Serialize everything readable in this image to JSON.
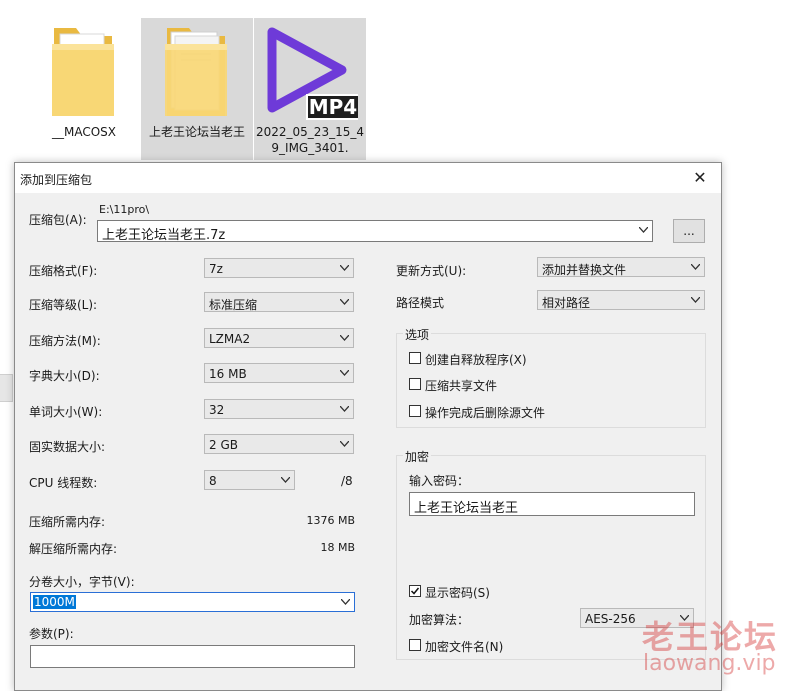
{
  "explorer": {
    "files": [
      {
        "name": "__MACOSX",
        "icon": "folder-icon"
      },
      {
        "name": "上老王论坛当老王",
        "icon": "folder-icon"
      },
      {
        "name": "2022_05_23_15_49_IMG_3401.",
        "icon": "mp4-video-icon",
        "badge": "MP4"
      }
    ]
  },
  "dialog": {
    "title": "添加到压缩包",
    "archive_label": "压缩包(A):",
    "archive_path": "E:\\11pro\\",
    "archive_name": "上老王论坛当老王.7z",
    "browse_label": "...",
    "left": {
      "format_label": "压缩格式(F):",
      "format_value": "7z",
      "level_label": "压缩等级(L):",
      "level_value": "标准压缩",
      "method_label": "压缩方法(M):",
      "method_value": "LZMA2",
      "dict_label": "字典大小(D):",
      "dict_value": "16 MB",
      "word_label": "单词大小(W):",
      "word_value": "32",
      "solid_label": "固实数据大小:",
      "solid_value": "2 GB",
      "threads_label": "CPU 线程数:",
      "threads_value": "8",
      "threads_max": "/8",
      "mem_compress_label": "压缩所需内存:",
      "mem_compress_value": "1376 MB",
      "mem_decompress_label": "解压缩所需内存:",
      "mem_decompress_value": "18 MB",
      "volume_label": "分卷大小，字节(V):",
      "volume_value": "1000M",
      "params_label": "参数(P):",
      "params_value": ""
    },
    "right": {
      "update_label": "更新方式(U):",
      "update_value": "添加并替换文件",
      "path_label": "路径模式",
      "path_value": "相对路径",
      "options_title": "选项",
      "opt_sfx": "创建自释放程序(X)",
      "opt_shared": "压缩共享文件",
      "opt_delete": "操作完成后删除源文件",
      "encrypt_title": "加密",
      "password_label": "输入密码：",
      "password_value": "上老王论坛当老王",
      "show_password": "显示密码(S)",
      "encrypt_method_label": "加密算法：",
      "encrypt_method_value": "AES-256",
      "encrypt_names": "加密文件名(N)"
    }
  },
  "watermark": {
    "line1": "老王论坛",
    "line2": "laowang.vip"
  },
  "colors": {
    "selection": "#0078d7",
    "folder": "#f8d775",
    "mp4_accent": "#6e3ad8"
  }
}
